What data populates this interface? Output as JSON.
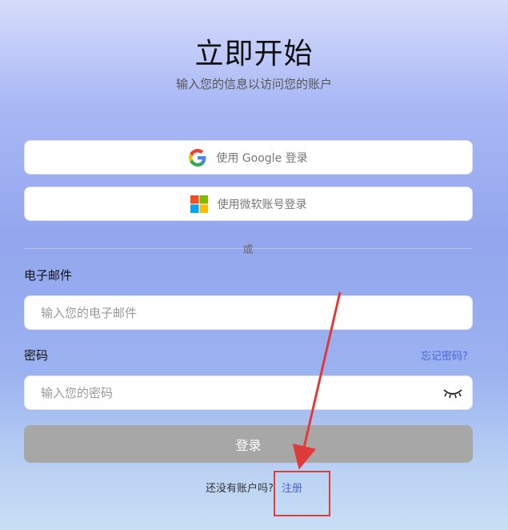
{
  "header": {
    "title": "立即开始",
    "subtitle": "输入您的信息以访问您的账户"
  },
  "sso": {
    "google_label": "使用 Google 登录",
    "google_icon": "google-icon",
    "microsoft_label": "使用微软账号登录",
    "microsoft_icon": "microsoft-icon"
  },
  "divider": {
    "text": "或"
  },
  "email": {
    "label": "电子邮件",
    "placeholder": "输入您的电子邮件",
    "value": ""
  },
  "password": {
    "label": "密码",
    "placeholder": "输入您的密码",
    "value": "",
    "forgot_label": "忘记密码?",
    "toggle_icon": "eye-closed-icon"
  },
  "login_button": {
    "label": "登录"
  },
  "signup": {
    "prompt": "还没有账户吗?",
    "link_label": "注册"
  },
  "colors": {
    "link": "#4a63d8",
    "annotation": "#e03b3b",
    "login_button_bg": "#a7a7a7"
  }
}
